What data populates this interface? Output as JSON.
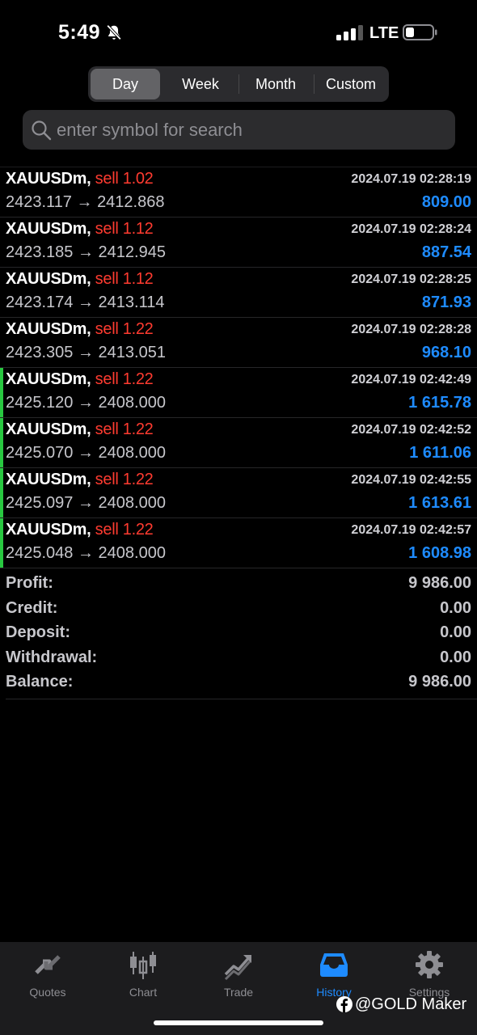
{
  "status": {
    "time": "5:49",
    "network": "LTE",
    "icons": [
      "bell-slash-icon",
      "signal-icon",
      "battery-icon"
    ]
  },
  "periods": {
    "items": [
      "Day",
      "Week",
      "Month",
      "Custom"
    ],
    "active": "Day"
  },
  "search": {
    "placeholder": "enter symbol for search"
  },
  "deals": [
    {
      "symbol": "XAUUSDm,",
      "side": "sell",
      "volume": "1.02",
      "open": "2423.117",
      "arrow": "→",
      "close": "2412.868",
      "time": "2024.07.19 02:28:19",
      "profit": "809.00"
    },
    {
      "symbol": "XAUUSDm,",
      "side": "sell",
      "volume": "1.12",
      "open": "2423.185",
      "arrow": "→",
      "close": "2412.945",
      "time": "2024.07.19 02:28:24",
      "profit": "887.54"
    },
    {
      "symbol": "XAUUSDm,",
      "side": "sell",
      "volume": "1.12",
      "open": "2423.174",
      "arrow": "→",
      "close": "2413.114",
      "time": "2024.07.19 02:28:25",
      "profit": "871.93"
    },
    {
      "symbol": "XAUUSDm,",
      "side": "sell",
      "volume": "1.22",
      "open": "2423.305",
      "arrow": "→",
      "close": "2413.051",
      "time": "2024.07.19 02:28:28",
      "profit": "968.10"
    },
    {
      "symbol": "XAUUSDm,",
      "side": "sell",
      "volume": "1.22",
      "open": "2425.120",
      "arrow": "→",
      "close": "2408.000",
      "time": "2024.07.19 02:42:49",
      "profit": "1 615.78"
    },
    {
      "symbol": "XAUUSDm,",
      "side": "sell",
      "volume": "1.22",
      "open": "2425.070",
      "arrow": "→",
      "close": "2408.000",
      "time": "2024.07.19 02:42:52",
      "profit": "1 611.06"
    },
    {
      "symbol": "XAUUSDm,",
      "side": "sell",
      "volume": "1.22",
      "open": "2425.097",
      "arrow": "→",
      "close": "2408.000",
      "time": "2024.07.19 02:42:55",
      "profit": "1 613.61"
    },
    {
      "symbol": "XAUUSDm,",
      "side": "sell",
      "volume": "1.22",
      "open": "2425.048",
      "arrow": "→",
      "close": "2408.000",
      "time": "2024.07.19 02:42:57",
      "profit": "1 608.98"
    }
  ],
  "summary": {
    "profit": {
      "label": "Profit:",
      "value": "9 986.00"
    },
    "credit": {
      "label": "Credit:",
      "value": "0.00"
    },
    "deposit": {
      "label": "Deposit:",
      "value": "0.00"
    },
    "withdrawal": {
      "label": "Withdrawal:",
      "value": "0.00"
    },
    "balance": {
      "label": "Balance:",
      "value": "9 986.00"
    }
  },
  "tabs": [
    {
      "label": "Quotes",
      "icon": "quotes-icon"
    },
    {
      "label": "Chart",
      "icon": "candlestick-chart-icon"
    },
    {
      "label": "Trade",
      "icon": "trade-icon"
    },
    {
      "label": "History",
      "icon": "history-inbox-icon",
      "active": true
    },
    {
      "label": "Settings",
      "icon": "gear-icon"
    }
  ],
  "watermark": {
    "text": "@GOLD Maker",
    "icon": "facebook-icon"
  },
  "colors": {
    "accent": "#1e8bff",
    "sell": "#ff3b30",
    "marker": "#28c840",
    "tabbar": "#1c1c1e"
  }
}
